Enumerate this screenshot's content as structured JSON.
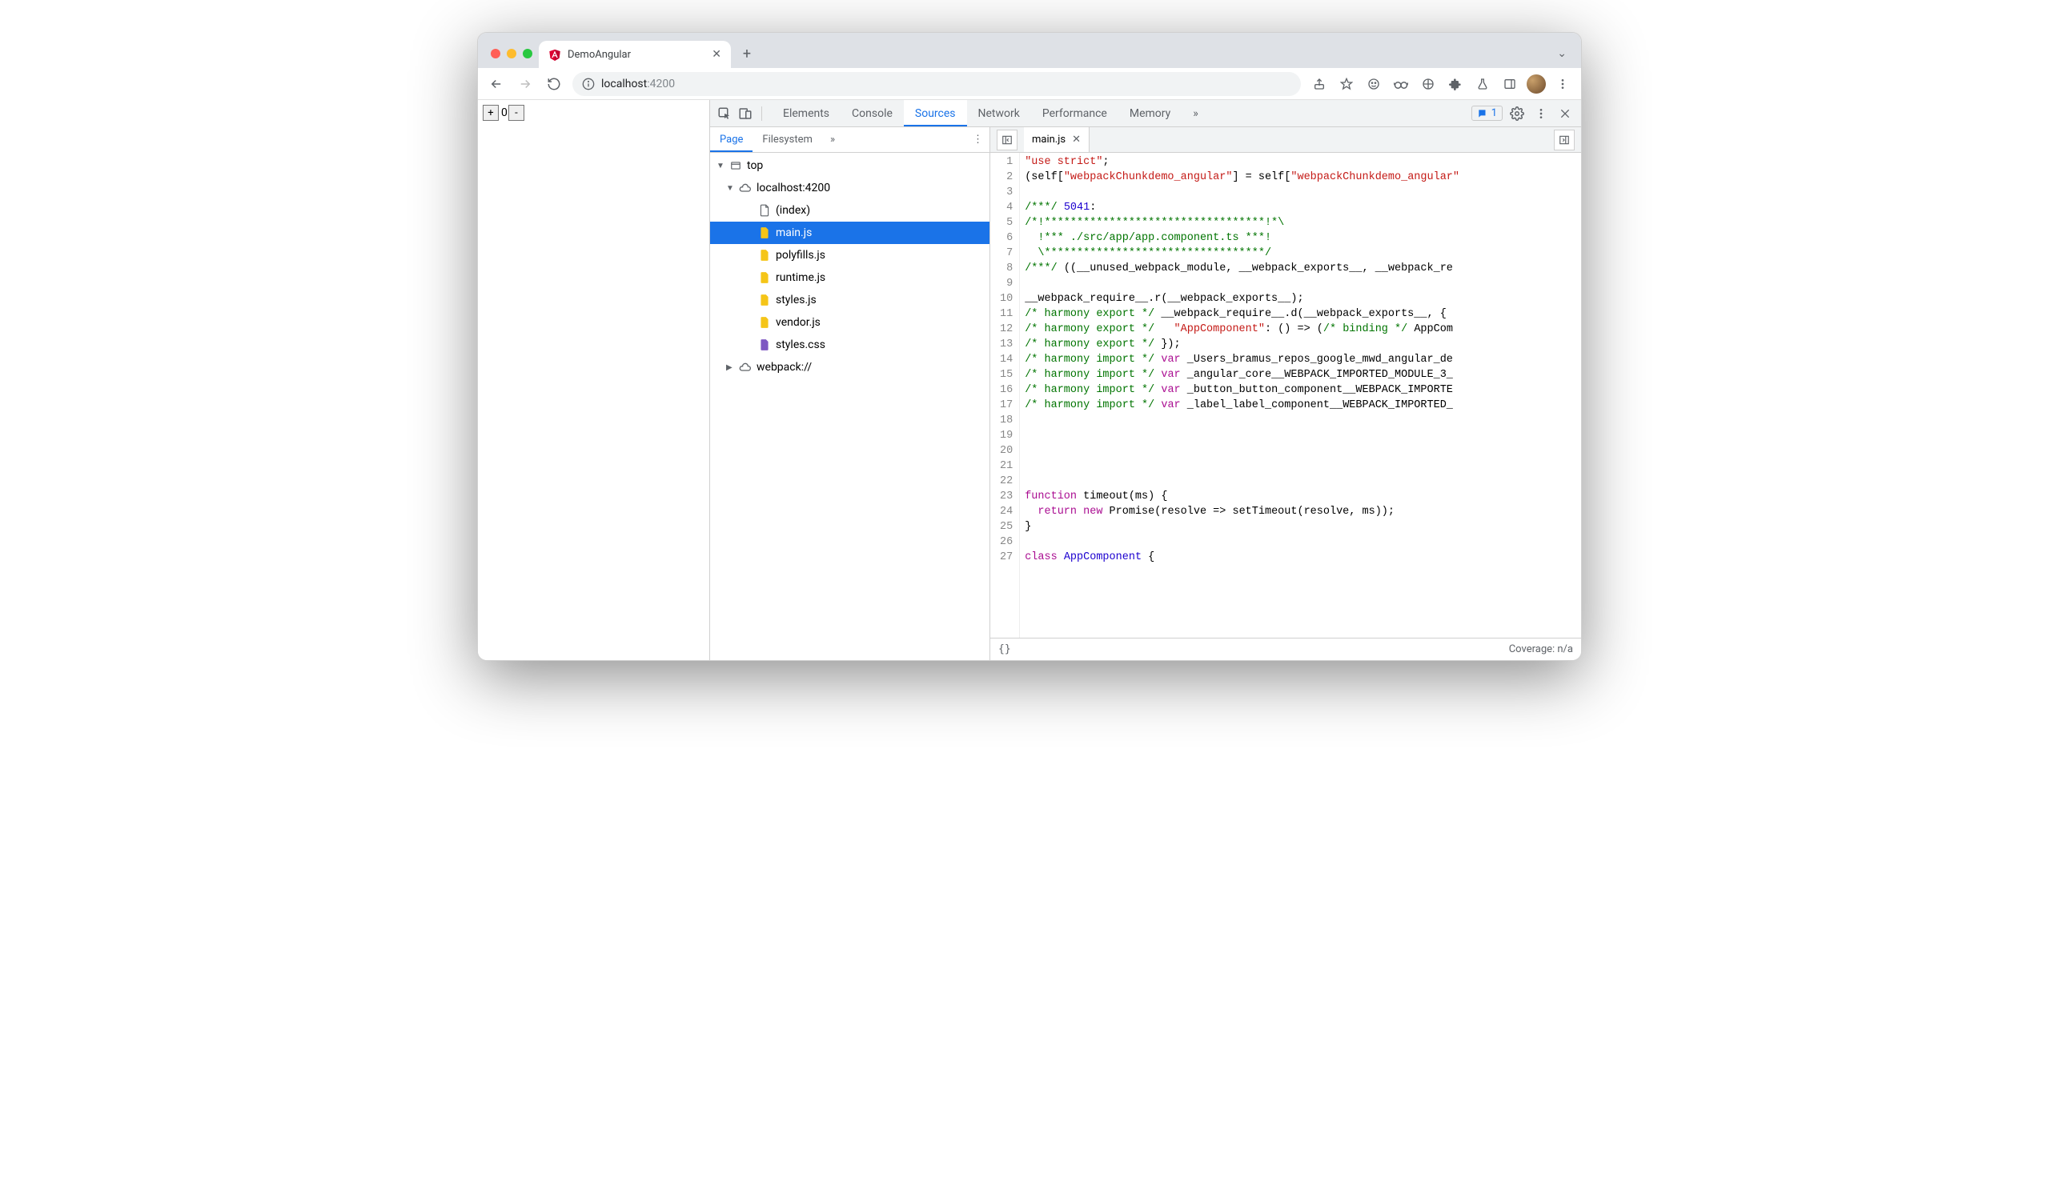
{
  "browser": {
    "tab_title": "DemoAngular",
    "url_display_prefix": "localhost",
    "url_display_suffix": ":4200"
  },
  "page": {
    "counter_value": "0",
    "plus": "+",
    "minus": "-"
  },
  "devtools": {
    "panels": [
      "Elements",
      "Console",
      "Sources",
      "Network",
      "Performance",
      "Memory"
    ],
    "active_panel": "Sources",
    "overflow": "»",
    "issues_count": "1",
    "nav_tabs": [
      "Page",
      "Filesystem"
    ],
    "active_nav_tab": "Page",
    "tree": {
      "top": "top",
      "host": "localhost:4200",
      "files": [
        "(index)",
        "main.js",
        "polyfills.js",
        "runtime.js",
        "styles.js",
        "vendor.js",
        "styles.css"
      ],
      "selected": "main.js",
      "webpack": "webpack://"
    },
    "open_file": "main.js",
    "status": {
      "braces": "{}",
      "coverage": "Coverage: n/a"
    }
  },
  "code": {
    "lines": [
      [
        {
          "t": "str",
          "v": "\"use strict\""
        },
        {
          "t": "plain",
          "v": ";"
        }
      ],
      [
        {
          "t": "plain",
          "v": "(self["
        },
        {
          "t": "str",
          "v": "\"webpackChunkdemo_angular\""
        },
        {
          "t": "plain",
          "v": "] = self["
        },
        {
          "t": "str",
          "v": "\"webpackChunkdemo_angular\""
        }
      ],
      [],
      [
        {
          "t": "comment",
          "v": "/***/ "
        },
        {
          "t": "num",
          "v": "5041"
        },
        {
          "t": "plain",
          "v": ":"
        }
      ],
      [
        {
          "t": "comment",
          "v": "/*!**********************************!*\\"
        }
      ],
      [
        {
          "t": "comment",
          "v": "  !*** ./src/app/app.component.ts ***!"
        }
      ],
      [
        {
          "t": "comment",
          "v": "  \\**********************************/"
        }
      ],
      [
        {
          "t": "comment",
          "v": "/***/"
        },
        {
          "t": "plain",
          "v": " ((__unused_webpack_module, __webpack_exports__, __webpack_re"
        }
      ],
      [],
      [
        {
          "t": "plain",
          "v": "__webpack_require__.r(__webpack_exports__);"
        }
      ],
      [
        {
          "t": "comment",
          "v": "/* harmony export */"
        },
        {
          "t": "plain",
          "v": " __webpack_require__.d(__webpack_exports__, {"
        }
      ],
      [
        {
          "t": "comment",
          "v": "/* harmony export */"
        },
        {
          "t": "plain",
          "v": "   "
        },
        {
          "t": "str",
          "v": "\"AppComponent\""
        },
        {
          "t": "plain",
          "v": ": () => ("
        },
        {
          "t": "comment",
          "v": "/* binding */"
        },
        {
          "t": "plain",
          "v": " AppCom"
        }
      ],
      [
        {
          "t": "comment",
          "v": "/* harmony export */"
        },
        {
          "t": "plain",
          "v": " });"
        }
      ],
      [
        {
          "t": "comment",
          "v": "/* harmony import */"
        },
        {
          "t": "plain",
          "v": " "
        },
        {
          "t": "kw",
          "v": "var"
        },
        {
          "t": "plain",
          "v": " _Users_bramus_repos_google_mwd_angular_de"
        }
      ],
      [
        {
          "t": "comment",
          "v": "/* harmony import */"
        },
        {
          "t": "plain",
          "v": " "
        },
        {
          "t": "kw",
          "v": "var"
        },
        {
          "t": "plain",
          "v": " _angular_core__WEBPACK_IMPORTED_MODULE_3_"
        }
      ],
      [
        {
          "t": "comment",
          "v": "/* harmony import */"
        },
        {
          "t": "plain",
          "v": " "
        },
        {
          "t": "kw",
          "v": "var"
        },
        {
          "t": "plain",
          "v": " _button_button_component__WEBPACK_IMPORTE"
        }
      ],
      [
        {
          "t": "comment",
          "v": "/* harmony import */"
        },
        {
          "t": "plain",
          "v": " "
        },
        {
          "t": "kw",
          "v": "var"
        },
        {
          "t": "plain",
          "v": " _label_label_component__WEBPACK_IMPORTED_"
        }
      ],
      [],
      [],
      [],
      [],
      [],
      [
        {
          "t": "kw",
          "v": "function"
        },
        {
          "t": "plain",
          "v": " timeout(ms) {"
        }
      ],
      [
        {
          "t": "plain",
          "v": "  "
        },
        {
          "t": "kw",
          "v": "return"
        },
        {
          "t": "plain",
          "v": " "
        },
        {
          "t": "kw",
          "v": "new"
        },
        {
          "t": "plain",
          "v": " Promise(resolve => setTimeout(resolve, ms));"
        }
      ],
      [
        {
          "t": "plain",
          "v": "}"
        }
      ],
      [],
      [
        {
          "t": "kw",
          "v": "class"
        },
        {
          "t": "plain",
          "v": " "
        },
        {
          "t": "blue",
          "v": "AppComponent"
        },
        {
          "t": "plain",
          "v": " {"
        }
      ]
    ]
  }
}
